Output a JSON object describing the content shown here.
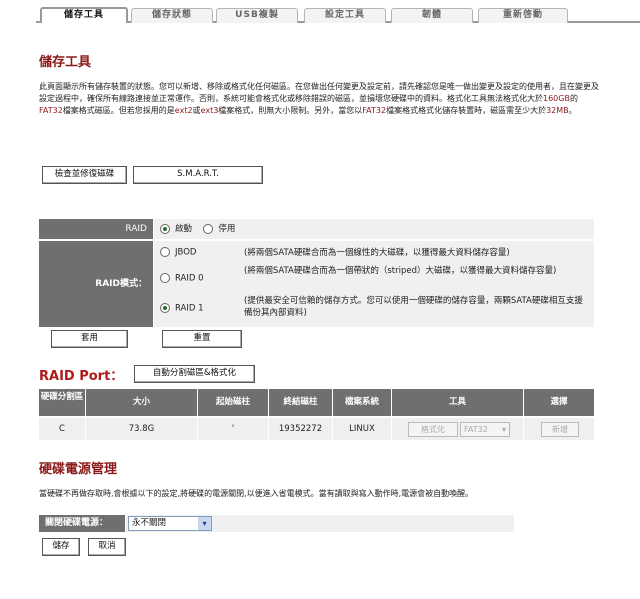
{
  "tabs": [
    "儲存工具",
    "儲存狀態",
    "USB複製",
    "設定工具",
    "韌體",
    "重新啓動"
  ],
  "page_title": "儲存工具",
  "intro": {
    "p1": "此頁面顯示所有儲存裝置的狀態。您可以新增、移除或格式化任何磁區。在您做出任何變更及設定前，請先確認您是唯一做出變更及設定的使用者，且在變更及設定過程中，確保所有線路連接並正常運作。否則，系統可能會格式化或移除錯誤的磁區，並損壞您硬碟中的資料。格式化工具無法格式化大於",
    "size1": "160GB",
    "p2": "的",
    "fs1": "FAT32",
    "p3": "檔案格式磁區。但若您採用的是",
    "fs2": "ext2",
    "p4": "或",
    "fs3": "ext3",
    "p5": "檔案格式，則無大小限制。另外，當您以",
    "fs4": "FAT32",
    "p6": "檔案格式格式化儲存裝置時，磁區需至少大於",
    "size2": "32MB",
    "p7": "。"
  },
  "buttons": {
    "check_repair": "檢查並修復磁碟",
    "smart": "S.M.A.R.T."
  },
  "raid": {
    "label": "RAID",
    "enable": "啟動",
    "disable": "停用",
    "enabled": true,
    "mode_label": "RAID模式：",
    "modes": [
      {
        "name": "JBOD",
        "desc": "(將兩個SATA硬碟合而為一個線性的大磁碟，以獲得最大資料儲存容量)",
        "selected": false
      },
      {
        "name": "RAID 0",
        "desc": "(將兩個SATA硬碟合而為一個帶狀的（striped）大磁碟，以獲得最大資料儲存容量)",
        "selected": false
      },
      {
        "name": "RAID 1",
        "desc": "(提供最安全可信賴的儲存方式。您可以使用一個硬碟的儲存容量，兩顆SATA硬碟相互支援備份其內部資料)",
        "selected": true
      }
    ],
    "apply": "套用",
    "reset": "重置"
  },
  "raid_port": {
    "title": "RAID Port：",
    "auto_button": "自動分割磁區&格式化",
    "headers": [
      "硬碟分割區",
      "大小",
      "起始磁柱",
      "終結磁柱",
      "檔案系統",
      "工具",
      "選擇"
    ],
    "rows": [
      {
        "partition": "C",
        "size": "73.8G",
        "start": "'",
        "end": "19352272",
        "fs": "LINUX",
        "format": "格式化",
        "fs_option": "FAT32",
        "add": "新增"
      }
    ]
  },
  "power": {
    "title": "硬碟電源管理",
    "desc": "當硬碟不再做存取時,會根據以下的設定,將硬碟的電源關閉,以便進入省電模式。當有讀取與寫入動作時,電源會被自動喚醒。",
    "label": "關閉硬碟電源：",
    "value": "永不關閉",
    "save": "儲存",
    "cancel": "取消"
  }
}
